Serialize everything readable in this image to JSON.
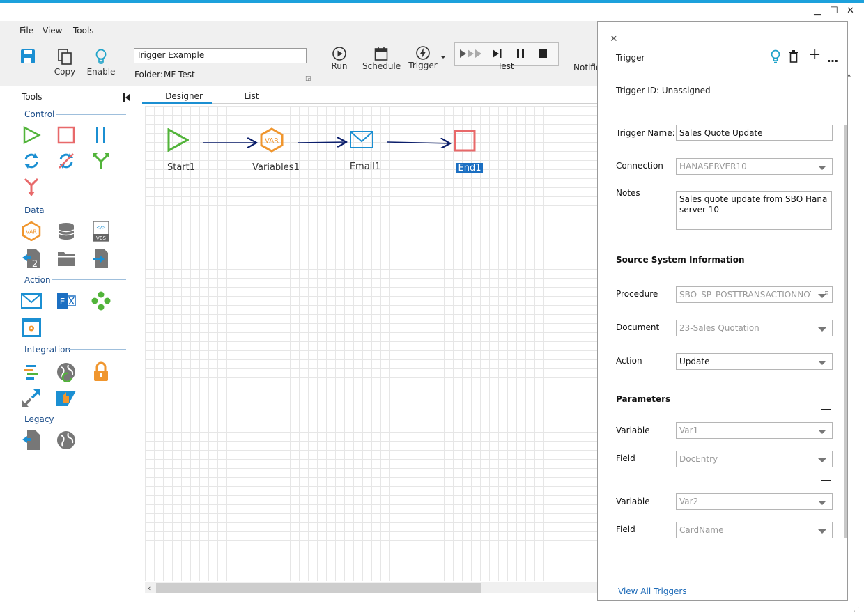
{
  "window": {
    "min": "▁",
    "max": "☐",
    "close": "✕"
  },
  "menu": [
    "File",
    "View",
    "Tools"
  ],
  "ribbon": {
    "copy": "Copy",
    "enable": "Enable",
    "name_value": "Trigger Example",
    "folder_label": "Folder:",
    "folder_value": "MF Test",
    "run": "Run",
    "schedule": "Schedule",
    "trigger": "Trigger",
    "test": "Test",
    "notifications": "Notific"
  },
  "tools": {
    "title": "Tools",
    "sections": [
      "Control",
      "Data",
      "Action",
      "Integration",
      "Legacy"
    ]
  },
  "tabs": {
    "designer": "Designer",
    "list": "List"
  },
  "nodes": [
    "Start1",
    "Variables1",
    "Email1",
    "End1"
  ],
  "panel": {
    "title": "Trigger",
    "trigger_id": "Trigger ID: Unassigned",
    "name_label": "Trigger Name:",
    "name_value": "Sales Quote Update",
    "connection_label": "Connection",
    "connection_value": "HANASERVER10",
    "notes_label": "Notes",
    "notes_value": "Sales quote update from SBO Hana server 10",
    "source_heading": "Source System Information",
    "procedure_label": "Procedure",
    "procedure_value": "SBO_SP_POSTTRANSACTIONNOTICE",
    "document_label": "Document",
    "document_value": "23-Sales Quotation",
    "action_label": "Action",
    "action_value": "Update",
    "params_heading": "Parameters",
    "params": [
      {
        "variable_label": "Variable",
        "variable_value": "Var1",
        "field_label": "Field",
        "field_value": "DocEntry"
      },
      {
        "variable_label": "Variable",
        "variable_value": "Var2",
        "field_label": "Field",
        "field_value": "CardName"
      }
    ],
    "view_all": "View All Triggers"
  }
}
